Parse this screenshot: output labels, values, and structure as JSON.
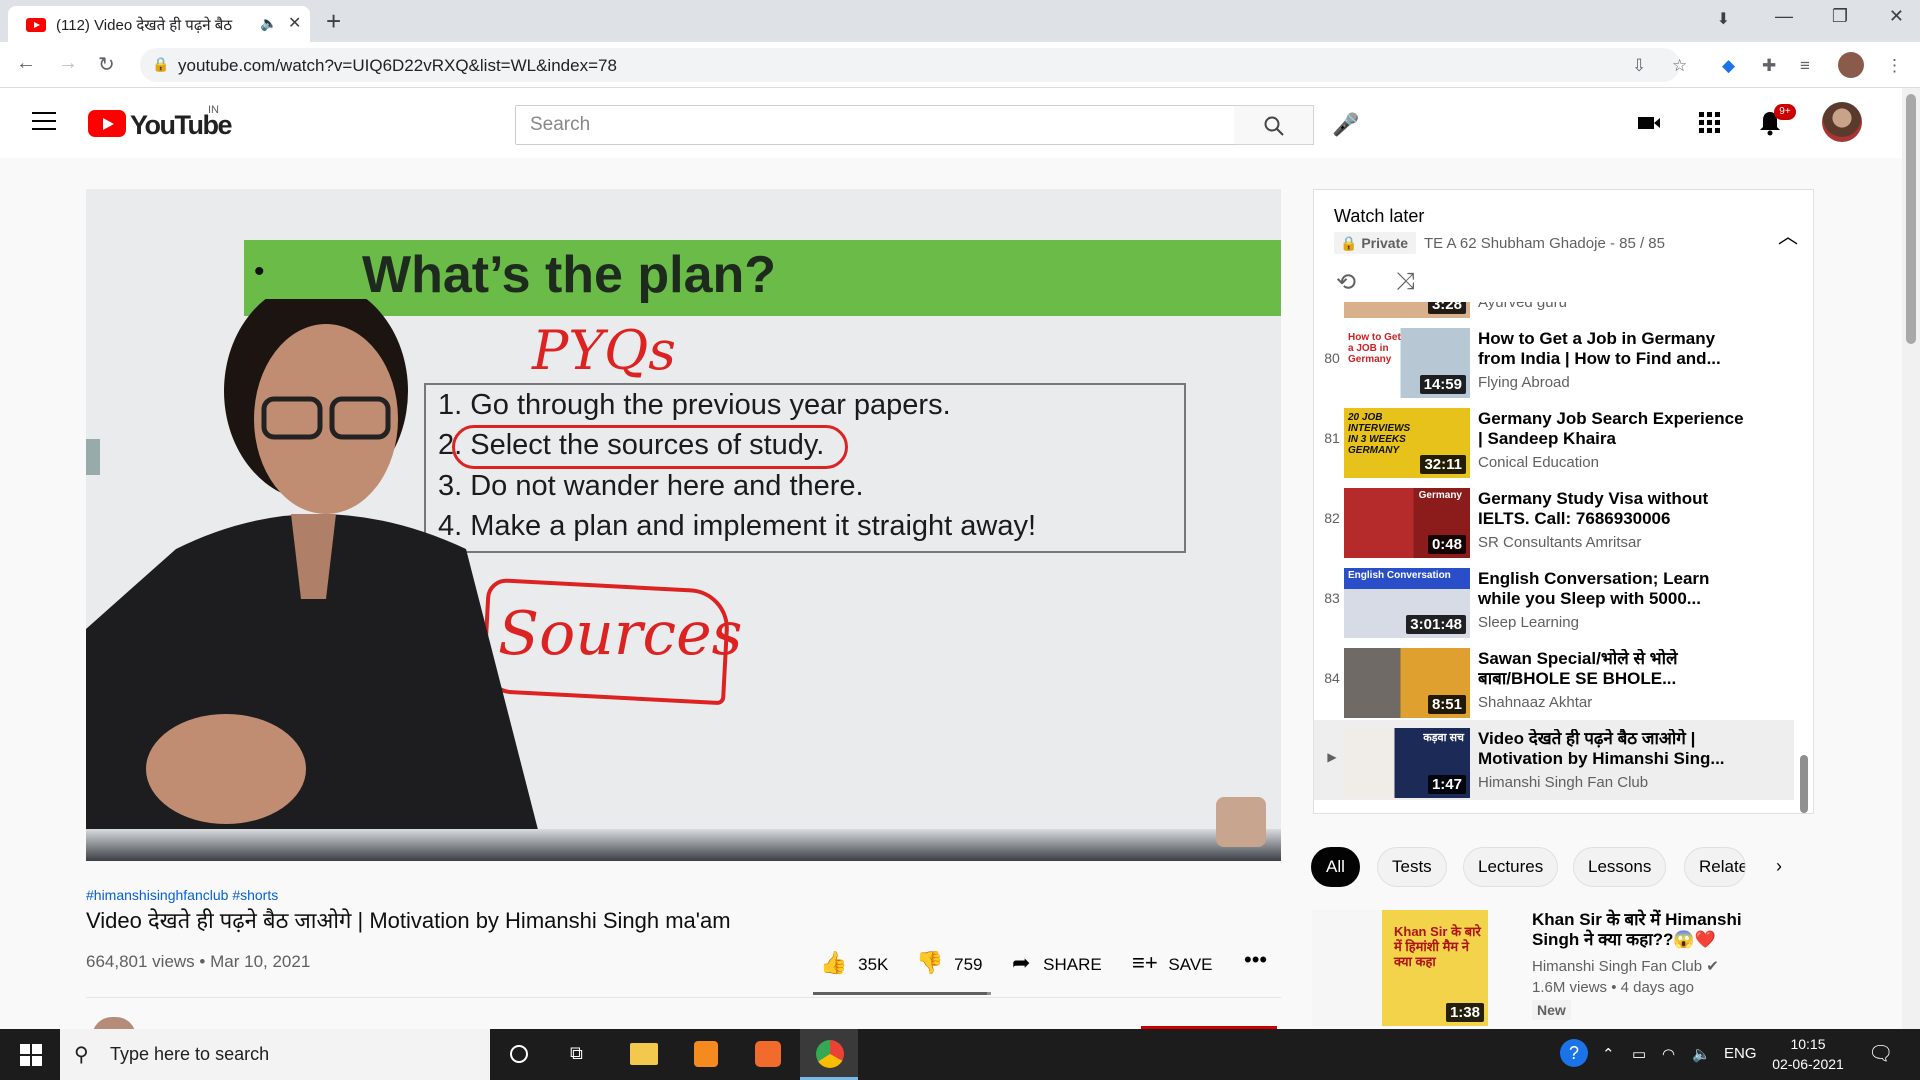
{
  "browser": {
    "tab_title": "(112) Video देखते ही पढ़ने बैठ",
    "url": "youtube.com/watch?v=UIQ6D22vRXQ&list=WL&index=78"
  },
  "youtube": {
    "logo_text": "YouTube",
    "country": "IN",
    "search_placeholder": "Search",
    "notification_count": "9+"
  },
  "video": {
    "slide_title": "What’s the plan?",
    "slide_bullet": "•",
    "handwritten_top": "PYQs",
    "slide_lines": [
      "1. Go through the previous year papers.",
      "2. Select the sources of study.",
      "3. Do not wander here and there.",
      "4. Make a plan and implement it straight away!"
    ],
    "handwritten_bottom": "Sources",
    "hashtags": "#himanshisinghfanclub #shorts",
    "title": "Video देखते ही पढ़ने बैठ जाओगे | Motivation by Himanshi Singh ma'am",
    "views": "664,801 views",
    "date": "Mar 10, 2021",
    "likes": "35K",
    "dislikes": "759",
    "like_ratio": 0.979,
    "share_label": "SHARE",
    "save_label": "SAVE"
  },
  "playlist": {
    "title": "Watch later",
    "privacy": "Private",
    "owner_progress": "TE A 62 Shubham Ghadoje - 85 / 85",
    "partial_item_channel": "Ayurved guru",
    "partial_item_duration": "3:28",
    "items": [
      {
        "index": "80",
        "title": "How to Get a Job in Germany from India | How to Find and...",
        "channel": "Flying Abroad",
        "duration": "14:59",
        "thumb_text": "How to Get a JOB in Germany"
      },
      {
        "index": "81",
        "title": "Germany Job Search Experience | Sandeep Khaira",
        "channel": "Conical Education",
        "duration": "32:11",
        "thumb_text": "20 JOB INTERVIEWS IN 3 WEEKS GERMANY"
      },
      {
        "index": "82",
        "title": "Germany Study Visa without IELTS. Call: 7686930006",
        "channel": "SR Consultants Amritsar",
        "duration": "0:48",
        "thumb_text": "Germany"
      },
      {
        "index": "83",
        "title": "English Conversation; Learn while you Sleep with 5000...",
        "channel": "Sleep Learning",
        "duration": "3:01:48",
        "thumb_text": "English Conversation"
      },
      {
        "index": "84",
        "title": "Sawan Special/भोले से भोले बाबा/BHOLE SE BHOLE...",
        "channel": "Shahnaaz Akhtar",
        "duration": "8:51",
        "thumb_text": ""
      },
      {
        "index": "▶",
        "title": "Video देखते ही पढ़ने बैठ जाओगे | Motivation by Himanshi Sing...",
        "channel": "Himanshi Singh Fan Club",
        "duration": "1:47",
        "thumb_text": "कड़वा सच"
      }
    ]
  },
  "chips": [
    "All",
    "Tests",
    "Lectures",
    "Lessons",
    "Relate"
  ],
  "related": {
    "title": "Khan Sir के बारे में Himanshi Singh ने क्या कहा??😱❤️",
    "channel": "Himanshi Singh Fan Club ✔",
    "meta": "1.6M views • 4 days ago",
    "badge": "New",
    "duration": "1:38",
    "thumb_text": "Khan Sir के बारे में हिमांशी मैम ने क्या कहा"
  },
  "taskbar": {
    "search_placeholder": "Type here to search",
    "language": "ENG",
    "time": "10:15",
    "date": "02-06-2021"
  }
}
